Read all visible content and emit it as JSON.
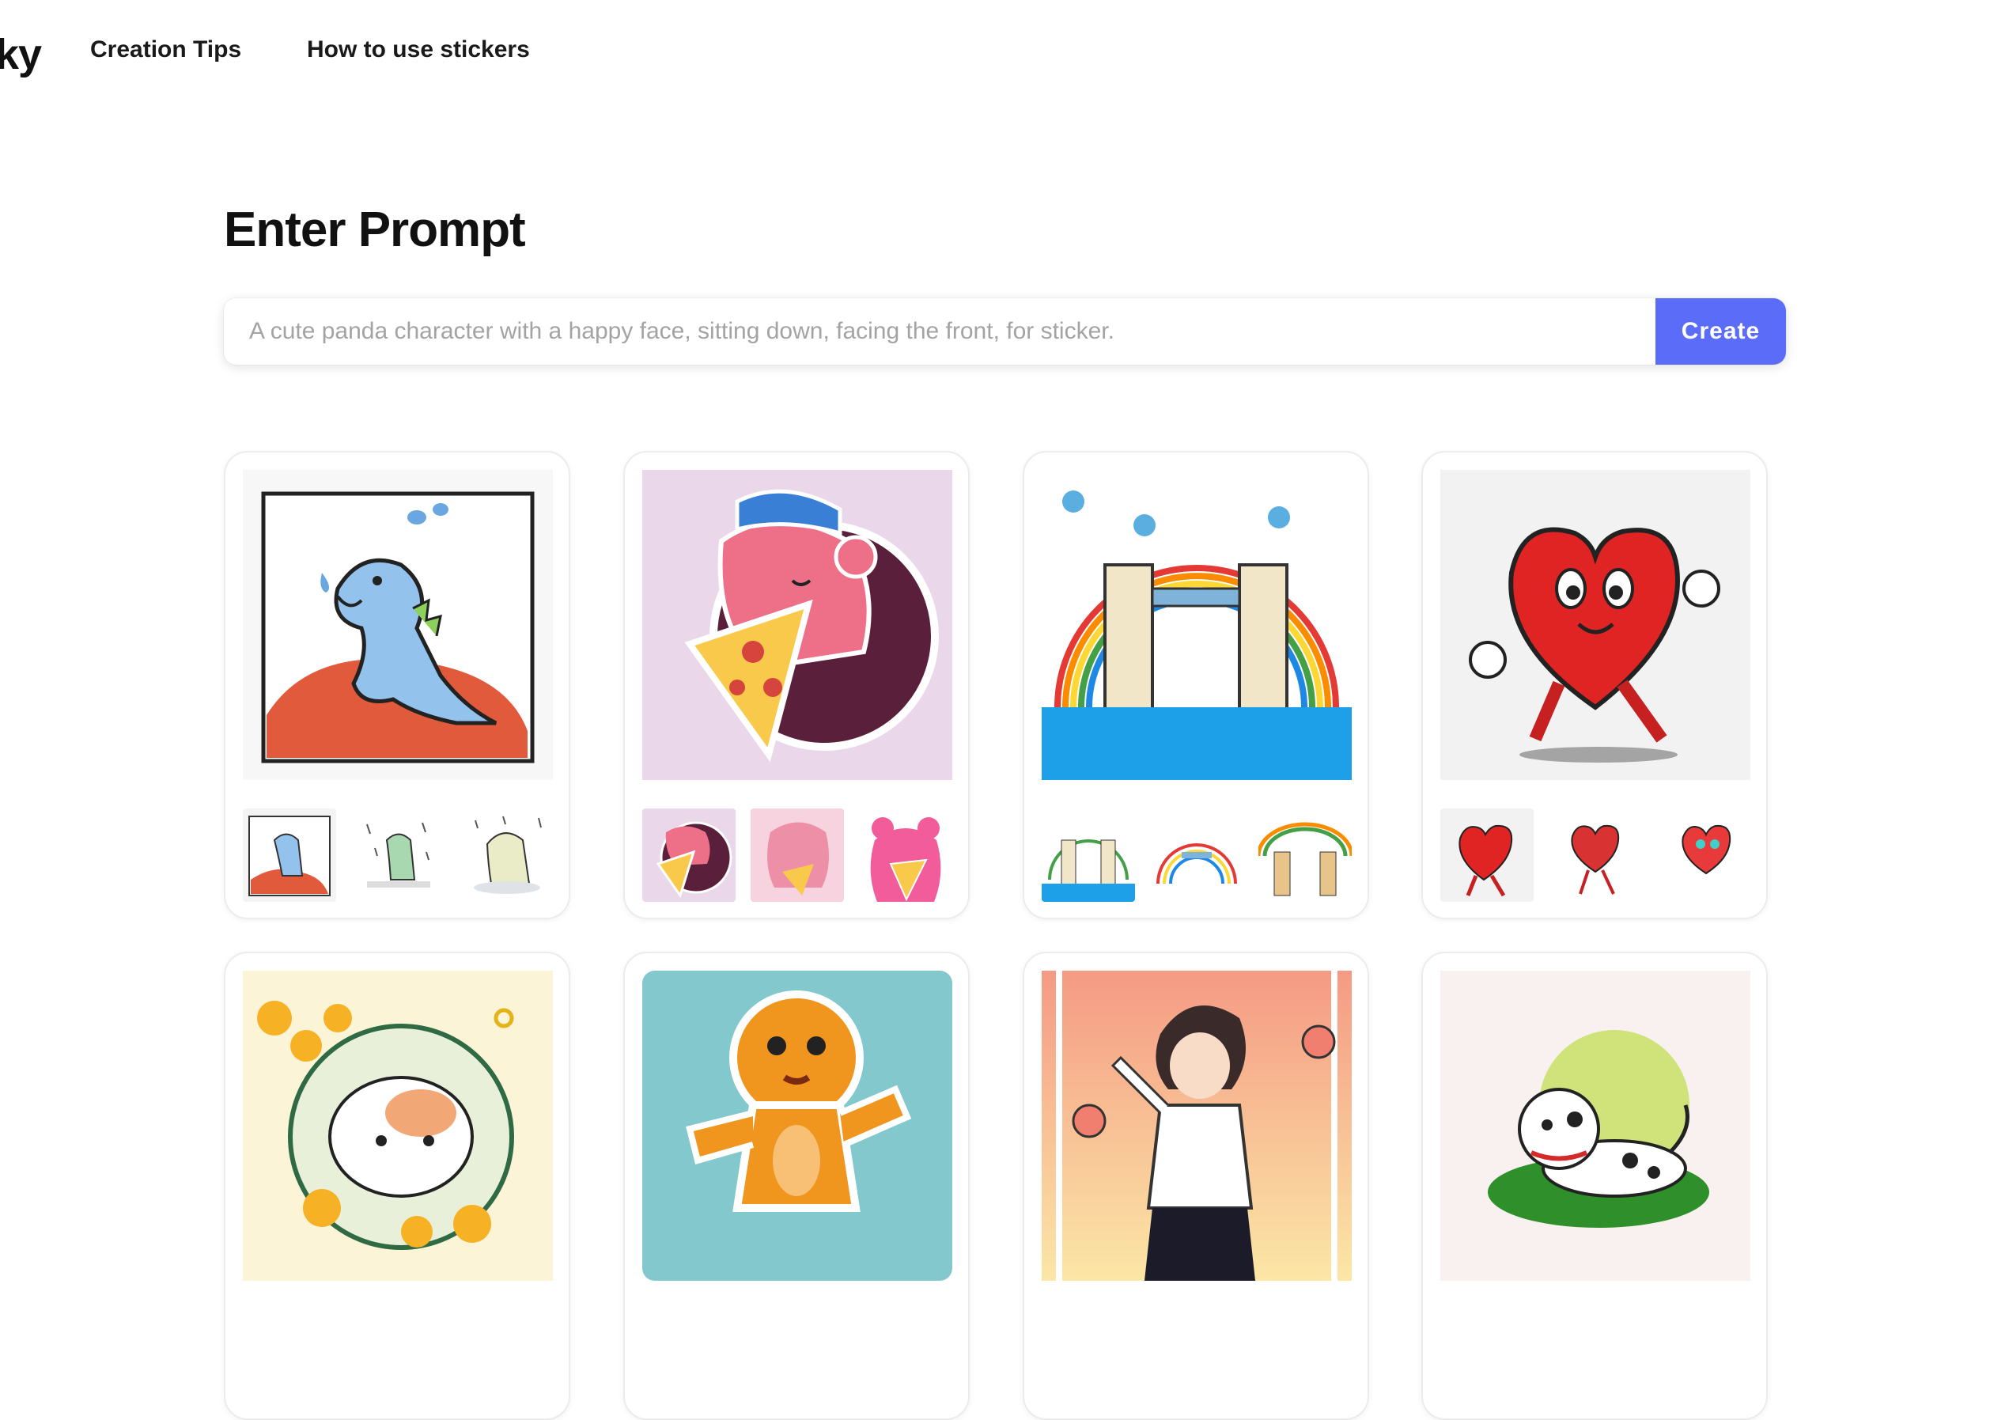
{
  "header": {
    "brand": "ky",
    "nav": [
      {
        "label": "Creation Tips"
      },
      {
        "label": "How to use stickers"
      }
    ]
  },
  "main": {
    "title": "Enter Prompt",
    "prompt": {
      "value": "",
      "placeholder": "A cute panda character with a happy face, sitting down, facing the front, for sticker."
    },
    "create_label": "Create"
  },
  "gallery": [
    {
      "subject": "crying dinosaur",
      "thumbnails": 3
    },
    {
      "subject": "pink bear eating pizza",
      "thumbnails": 3
    },
    {
      "subject": "tower bridge with rainbow",
      "thumbnails": 3
    },
    {
      "subject": "walking heart",
      "thumbnails": 3
    },
    {
      "subject": "hamster in flowers",
      "thumbnails": 0
    },
    {
      "subject": "gingerbread man running",
      "thumbnails": 0
    },
    {
      "subject": "anime dancer",
      "thumbnails": 0
    },
    {
      "subject": "dalmatian puppy",
      "thumbnails": 0
    }
  ],
  "colors": {
    "accent": "#5b6cf9",
    "card_border": "#ececec",
    "placeholder_text": "#a3a3a3"
  },
  "icons": [
    "dinosaur-sticker",
    "bear-pizza-sticker",
    "bridge-rainbow-sticker",
    "heart-sticker",
    "hamster-sticker",
    "gingerbread-sticker",
    "anime-sticker",
    "dalmatian-sticker"
  ]
}
